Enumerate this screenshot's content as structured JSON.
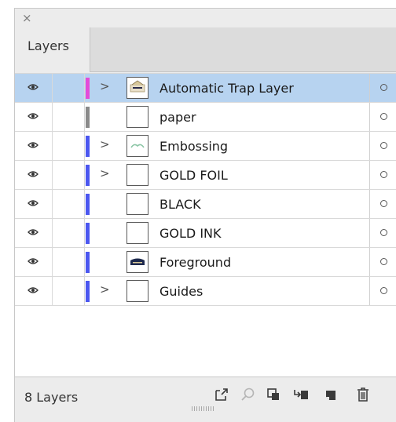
{
  "panel": {
    "close_glyph": "×",
    "tab_label": "Layers"
  },
  "layers": [
    {
      "name": "Automatic Trap Layer",
      "color": "#e44bd8",
      "expandable": true,
      "selected": true,
      "thumb": "image"
    },
    {
      "name": "paper",
      "color": "#8a8a8a",
      "expandable": false,
      "selected": false,
      "thumb": "blank"
    },
    {
      "name": "Embossing",
      "color": "#4b57f0",
      "expandable": true,
      "selected": false,
      "thumb": "emboss"
    },
    {
      "name": "GOLD FOIL",
      "color": "#4b57f0",
      "expandable": true,
      "selected": false,
      "thumb": "blank"
    },
    {
      "name": "BLACK",
      "color": "#4b57f0",
      "expandable": false,
      "selected": false,
      "thumb": "blank"
    },
    {
      "name": "GOLD INK",
      "color": "#4b57f0",
      "expandable": false,
      "selected": false,
      "thumb": "blank"
    },
    {
      "name": "Foreground",
      "color": "#4b57f0",
      "expandable": false,
      "selected": false,
      "thumb": "dark"
    },
    {
      "name": "Guides",
      "color": "#4b57f0",
      "expandable": true,
      "selected": false,
      "thumb": "blank"
    }
  ],
  "footer": {
    "count_label": "8 Layers",
    "icons": [
      "export-icon",
      "locate-icon",
      "clipping-mask-icon",
      "new-sublayer-icon",
      "new-layer-icon",
      "trash-icon"
    ]
  }
}
